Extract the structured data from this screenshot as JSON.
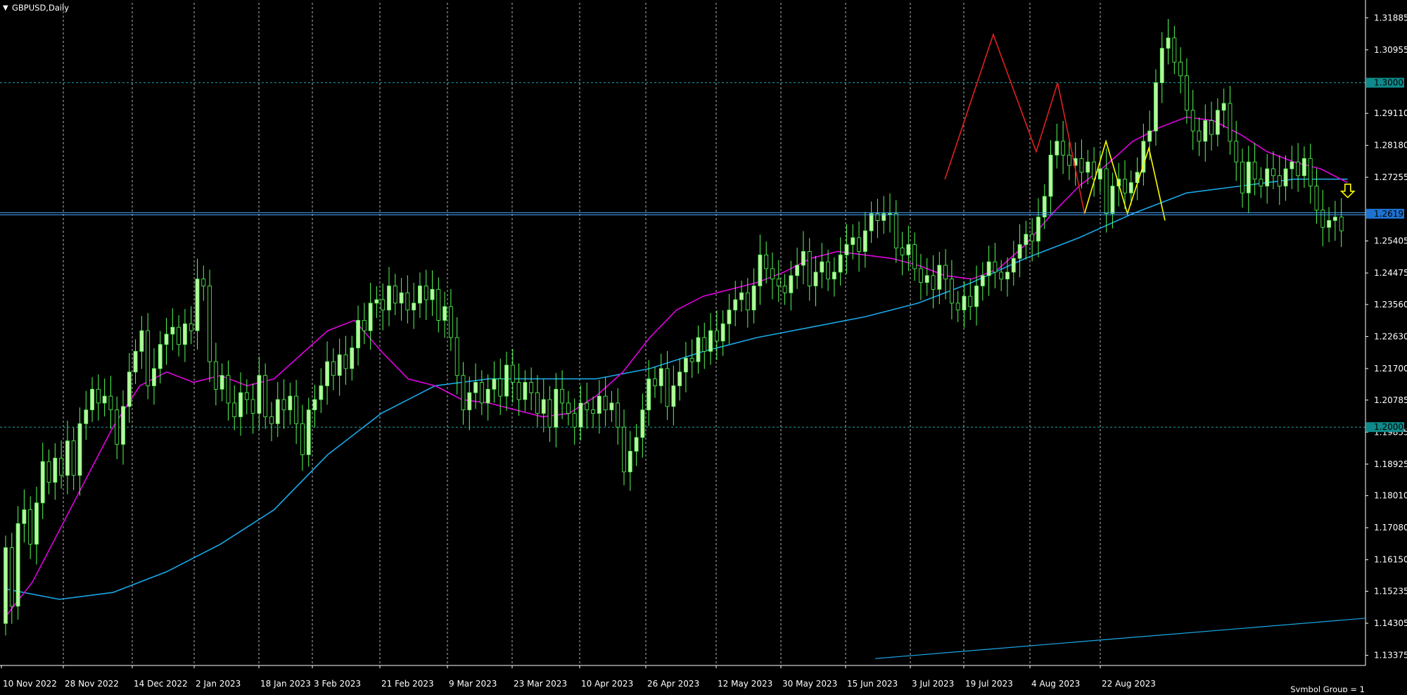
{
  "window": {
    "title": "GBPUSD,Daily"
  },
  "footer": {
    "symbol_group": "Symbol Group = 1"
  },
  "colors": {
    "background": "#000000",
    "grid": "#c8c8c8",
    "bull_candle": "#b8f5a0",
    "bear_candle": "#000000",
    "candle_outline": "#55ff55",
    "ma_fast": "#e000e0",
    "ma_slow": "#1aa8e8",
    "hline": "#4aa8ff",
    "level_line": "#20a0a0",
    "pattern_red": "#e02020",
    "pattern_yellow": "#ffff00",
    "axis_text": "#ffffff",
    "price_tag_level": "#0e8a8a",
    "price_tag_hline": "#1e73d2"
  },
  "chart_data": {
    "type": "candlestick",
    "symbol": "GBPUSD",
    "timeframe": "Daily",
    "y_ticks": [
      "1.31885",
      "1.30955",
      "1.29110",
      "1.28180",
      "1.27255",
      "1.25405",
      "1.24475",
      "1.23560",
      "1.22630",
      "1.21700",
      "1.20785",
      "1.19855",
      "1.18925",
      "1.18010",
      "1.17080",
      "1.16150",
      "1.15235",
      "1.14305",
      "1.13375"
    ],
    "x_ticks": [
      "10 Nov 2022",
      "28 Nov 2022",
      "14 Dec 2022",
      "2 Jan 2023",
      "18 Jan 2023",
      "3 Feb 2023",
      "21 Feb 2023",
      "9 Mar 2023",
      "23 Mar 2023",
      "10 Apr 2023",
      "26 Apr 2023",
      "12 May 2023",
      "30 May 2023",
      "15 Jun 2023",
      "3 Jul 2023",
      "19 Jul 2023",
      "4 Aug 2023",
      "22 Aug 2023"
    ],
    "ylim": [
      1.1308,
      1.3232
    ],
    "x_range": [
      0,
      208
    ],
    "level_lines": [
      {
        "label": "1.30000",
        "value": 1.3
      },
      {
        "label": "1.20000",
        "value": 1.2
      }
    ],
    "horizontal_line": {
      "label": "1.26196",
      "value": 1.26196
    },
    "candles": [
      [
        1.143,
        1.165
      ],
      [
        1.165,
        1.148
      ],
      [
        1.148,
        1.172
      ],
      [
        1.172,
        1.176
      ],
      [
        1.176,
        1.166
      ],
      [
        1.166,
        1.178
      ],
      [
        1.178,
        1.19
      ],
      [
        1.19,
        1.184
      ],
      [
        1.184,
        1.191
      ],
      [
        1.191,
        1.186
      ],
      [
        1.186,
        1.196
      ],
      [
        1.196,
        1.186
      ],
      [
        1.186,
        1.201
      ],
      [
        1.201,
        1.205
      ],
      [
        1.205,
        1.211
      ],
      [
        1.211,
        1.207
      ],
      [
        1.207,
        1.209
      ],
      [
        1.209,
        1.205
      ],
      [
        1.205,
        1.195
      ],
      [
        1.195,
        1.206
      ],
      [
        1.206,
        1.216
      ],
      [
        1.216,
        1.222
      ],
      [
        1.222,
        1.228
      ],
      [
        1.228,
        1.212
      ],
      [
        1.212,
        1.217
      ],
      [
        1.217,
        1.224
      ],
      [
        1.224,
        1.227
      ],
      [
        1.227,
        1.229
      ],
      [
        1.229,
        1.224
      ],
      [
        1.224,
        1.23
      ],
      [
        1.23,
        1.228
      ],
      [
        1.228,
        1.243
      ],
      [
        1.243,
        1.241
      ],
      [
        1.241,
        1.219
      ],
      [
        1.219,
        1.211
      ],
      [
        1.211,
        1.215
      ],
      [
        1.215,
        1.207
      ],
      [
        1.207,
        1.203
      ],
      [
        1.203,
        1.21
      ],
      [
        1.21,
        1.208
      ],
      [
        1.208,
        1.204
      ],
      [
        1.204,
        1.215
      ],
      [
        1.215,
        1.203
      ],
      [
        1.203,
        1.201
      ],
      [
        1.201,
        1.208
      ],
      [
        1.208,
        1.205
      ],
      [
        1.205,
        1.209
      ],
      [
        1.209,
        1.201
      ],
      [
        1.201,
        1.192
      ],
      [
        1.192,
        1.205
      ],
      [
        1.205,
        1.208
      ],
      [
        1.208,
        1.212
      ],
      [
        1.212,
        1.219
      ],
      [
        1.219,
        1.215
      ],
      [
        1.215,
        1.221
      ],
      [
        1.221,
        1.217
      ],
      [
        1.217,
        1.223
      ],
      [
        1.223,
        1.231
      ],
      [
        1.231,
        1.228
      ],
      [
        1.228,
        1.236
      ],
      [
        1.236,
        1.237
      ],
      [
        1.237,
        1.234
      ],
      [
        1.234,
        1.241
      ],
      [
        1.241,
        1.236
      ],
      [
        1.236,
        1.239
      ],
      [
        1.239,
        1.234
      ],
      [
        1.234,
        1.236
      ],
      [
        1.236,
        1.241
      ],
      [
        1.241,
        1.237
      ],
      [
        1.237,
        1.24
      ],
      [
        1.24,
        1.231
      ],
      [
        1.231,
        1.235
      ],
      [
        1.235,
        1.226
      ],
      [
        1.226,
        1.215
      ],
      [
        1.215,
        1.205
      ],
      [
        1.205,
        1.21
      ],
      [
        1.21,
        1.213
      ],
      [
        1.213,
        1.207
      ],
      [
        1.207,
        1.211
      ],
      [
        1.211,
        1.214
      ],
      [
        1.214,
        1.209
      ],
      [
        1.209,
        1.218
      ],
      [
        1.218,
        1.213
      ],
      [
        1.213,
        1.208
      ],
      [
        1.208,
        1.213
      ],
      [
        1.213,
        1.21
      ],
      [
        1.21,
        1.204
      ],
      [
        1.204,
        1.208
      ],
      [
        1.208,
        1.2
      ],
      [
        1.2,
        1.211
      ],
      [
        1.211,
        1.207
      ],
      [
        1.207,
        1.204
      ],
      [
        1.204,
        1.2
      ],
      [
        1.2,
        1.207
      ],
      [
        1.207,
        1.205
      ],
      [
        1.205,
        1.204
      ],
      [
        1.204,
        1.209
      ],
      [
        1.209,
        1.205
      ],
      [
        1.205,
        1.207
      ],
      [
        1.207,
        1.2
      ],
      [
        1.2,
        1.187
      ],
      [
        1.187,
        1.193
      ],
      [
        1.193,
        1.197
      ],
      [
        1.197,
        1.205
      ],
      [
        1.205,
        1.214
      ],
      [
        1.214,
        1.212
      ],
      [
        1.212,
        1.217
      ],
      [
        1.217,
        1.206
      ],
      [
        1.206,
        1.212
      ],
      [
        1.212,
        1.216
      ],
      [
        1.216,
        1.22
      ],
      [
        1.22,
        1.219
      ],
      [
        1.219,
        1.226
      ],
      [
        1.226,
        1.222
      ],
      [
        1.222,
        1.228
      ],
      [
        1.228,
        1.225
      ],
      [
        1.225,
        1.23
      ],
      [
        1.23,
        1.234
      ],
      [
        1.234,
        1.237
      ],
      [
        1.237,
        1.239
      ],
      [
        1.239,
        1.234
      ],
      [
        1.234,
        1.241
      ],
      [
        1.241,
        1.25
      ],
      [
        1.25,
        1.246
      ],
      [
        1.246,
        1.243
      ],
      [
        1.243,
        1.241
      ],
      [
        1.241,
        1.239
      ],
      [
        1.239,
        1.244
      ],
      [
        1.244,
        1.247
      ],
      [
        1.247,
        1.251
      ],
      [
        1.251,
        1.241
      ],
      [
        1.241,
        1.245
      ],
      [
        1.245,
        1.248
      ],
      [
        1.248,
        1.243
      ],
      [
        1.243,
        1.245
      ],
      [
        1.245,
        1.25
      ],
      [
        1.25,
        1.253
      ],
      [
        1.253,
        1.255
      ],
      [
        1.255,
        1.251
      ],
      [
        1.251,
        1.257
      ],
      [
        1.257,
        1.262
      ],
      [
        1.262,
        1.26
      ],
      [
        1.26,
        1.262
      ],
      [
        1.262,
        1.262
      ],
      [
        1.262,
        1.252
      ],
      [
        1.252,
        1.25
      ],
      [
        1.25,
        1.253
      ],
      [
        1.253,
        1.246
      ],
      [
        1.246,
        1.242
      ],
      [
        1.242,
        1.244
      ],
      [
        1.244,
        1.24
      ],
      [
        1.24,
        1.247
      ],
      [
        1.247,
        1.243
      ],
      [
        1.243,
        1.236
      ],
      [
        1.236,
        1.234
      ],
      [
        1.234,
        1.238
      ],
      [
        1.238,
        1.235
      ],
      [
        1.235,
        1.241
      ],
      [
        1.241,
        1.244
      ],
      [
        1.244,
        1.248
      ],
      [
        1.248,
        1.245
      ],
      [
        1.245,
        1.243
      ],
      [
        1.243,
        1.245
      ],
      [
        1.245,
        1.249
      ],
      [
        1.249,
        1.253
      ],
      [
        1.253,
        1.256
      ],
      [
        1.256,
        1.254
      ],
      [
        1.254,
        1.261
      ],
      [
        1.261,
        1.267
      ],
      [
        1.267,
        1.279
      ],
      [
        1.279,
        1.283
      ],
      [
        1.283,
        1.279
      ],
      [
        1.279,
        1.276
      ],
      [
        1.276,
        1.278
      ],
      [
        1.278,
        1.274
      ],
      [
        1.274,
        1.277
      ],
      [
        1.277,
        1.272
      ],
      [
        1.272,
        1.275
      ],
      [
        1.275,
        1.262
      ],
      [
        1.262,
        1.27
      ],
      [
        1.27,
        1.272
      ],
      [
        1.272,
        1.268
      ],
      [
        1.268,
        1.271
      ],
      [
        1.271,
        1.274
      ],
      [
        1.274,
        1.283
      ],
      [
        1.283,
        1.286
      ],
      [
        1.286,
        1.3
      ],
      [
        1.3,
        1.31
      ],
      [
        1.31,
        1.313
      ],
      [
        1.313,
        1.306
      ],
      [
        1.306,
        1.302
      ],
      [
        1.302,
        1.292
      ],
      [
        1.292,
        1.286
      ],
      [
        1.286,
        1.283
      ],
      [
        1.283,
        1.289
      ],
      [
        1.289,
        1.285
      ],
      [
        1.285,
        1.292
      ],
      [
        1.292,
        1.294
      ],
      [
        1.294,
        1.283
      ],
      [
        1.283,
        1.277
      ],
      [
        1.277,
        1.268
      ],
      [
        1.268,
        1.277
      ],
      [
        1.277,
        1.272
      ],
      [
        1.272,
        1.27
      ],
      [
        1.27,
        1.275
      ],
      [
        1.275,
        1.273
      ],
      [
        1.273,
        1.27
      ],
      [
        1.27,
        1.275
      ],
      [
        1.275,
        1.277
      ],
      [
        1.277,
        1.273
      ],
      [
        1.273,
        1.278
      ],
      [
        1.278,
        1.27
      ],
      [
        1.27,
        1.263
      ],
      [
        1.263,
        1.258
      ],
      [
        1.258,
        1.26
      ],
      [
        1.26,
        1.261
      ],
      [
        1.261,
        1.257
      ]
    ],
    "ma_fast": [
      [
        0,
        1.145
      ],
      [
        5,
        1.155
      ],
      [
        10,
        1.17
      ],
      [
        15,
        1.185
      ],
      [
        20,
        1.2
      ],
      [
        25,
        1.212
      ],
      [
        30,
        1.216
      ],
      [
        35,
        1.213
      ],
      [
        40,
        1.215
      ],
      [
        45,
        1.212
      ],
      [
        50,
        1.214
      ],
      [
        55,
        1.221
      ],
      [
        60,
        1.228
      ],
      [
        65,
        1.231
      ],
      [
        70,
        1.222
      ],
      [
        75,
        1.214
      ],
      [
        80,
        1.212
      ],
      [
        85,
        1.208
      ],
      [
        90,
        1.207
      ],
      [
        95,
        1.205
      ],
      [
        100,
        1.203
      ],
      [
        105,
        1.204
      ],
      [
        110,
        1.209
      ],
      [
        115,
        1.216
      ],
      [
        120,
        1.226
      ],
      [
        125,
        1.234
      ],
      [
        130,
        1.238
      ],
      [
        135,
        1.24
      ],
      [
        140,
        1.242
      ],
      [
        145,
        1.245
      ],
      [
        150,
        1.249
      ],
      [
        155,
        1.251
      ],
      [
        160,
        1.25
      ],
      [
        165,
        1.249
      ],
      [
        170,
        1.247
      ],
      [
        175,
        1.244
      ],
      [
        180,
        1.243
      ],
      [
        185,
        1.246
      ],
      [
        190,
        1.253
      ],
      [
        195,
        1.262
      ],
      [
        200,
        1.27
      ],
      [
        205,
        1.276
      ],
      [
        210,
        1.283
      ],
      [
        215,
        1.287
      ],
      [
        220,
        1.29
      ],
      [
        225,
        1.289
      ],
      [
        230,
        1.285
      ],
      [
        235,
        1.28
      ],
      [
        240,
        1.277
      ],
      [
        245,
        1.275
      ],
      [
        250,
        1.271
      ]
    ],
    "ma_slow": [
      [
        0,
        1.153
      ],
      [
        10,
        1.15
      ],
      [
        20,
        1.152
      ],
      [
        30,
        1.158
      ],
      [
        40,
        1.166
      ],
      [
        50,
        1.176
      ],
      [
        60,
        1.192
      ],
      [
        70,
        1.204
      ],
      [
        80,
        1.212
      ],
      [
        90,
        1.214
      ],
      [
        100,
        1.214
      ],
      [
        110,
        1.214
      ],
      [
        120,
        1.217
      ],
      [
        130,
        1.222
      ],
      [
        140,
        1.226
      ],
      [
        150,
        1.229
      ],
      [
        160,
        1.232
      ],
      [
        170,
        1.236
      ],
      [
        180,
        1.242
      ],
      [
        190,
        1.249
      ],
      [
        200,
        1.255
      ],
      [
        210,
        1.262
      ],
      [
        220,
        1.268
      ],
      [
        230,
        1.27
      ],
      [
        240,
        1.272
      ],
      [
        250,
        1.272
      ]
    ],
    "pattern_red": [
      [
        175,
        1.272
      ],
      [
        184,
        1.314
      ],
      [
        192,
        1.28
      ],
      [
        196,
        1.3
      ],
      [
        201,
        1.262
      ]
    ],
    "pattern_yellow": [
      [
        201,
        1.262
      ],
      [
        205,
        1.283
      ],
      [
        209,
        1.262
      ],
      [
        213,
        1.281
      ],
      [
        216,
        1.26
      ]
    ],
    "trendline": [
      [
        162,
        1.1328
      ],
      [
        222,
        1.1445
      ]
    ]
  }
}
